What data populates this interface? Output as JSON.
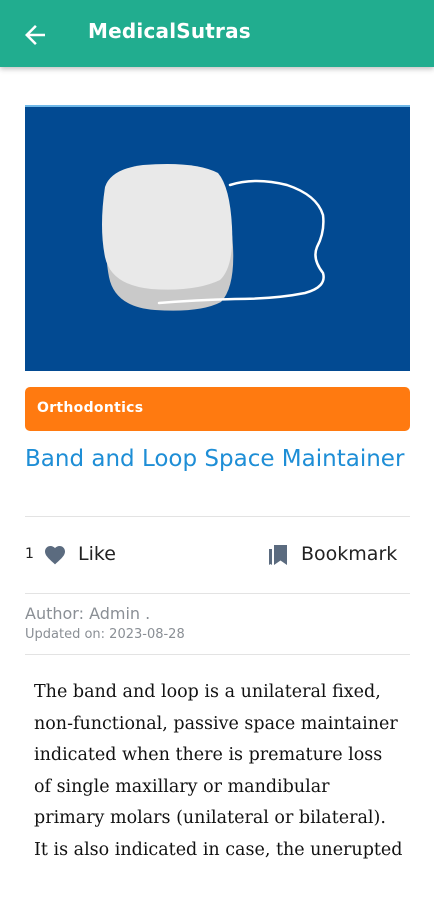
{
  "appbar": {
    "title": "MedicalSutras"
  },
  "article": {
    "category": "Orthodontics",
    "title": "Band and Loop Space Maintainer",
    "like_count": "1",
    "like_label": "Like",
    "bookmark_label": "Bookmark",
    "author": "Author: Admin .",
    "updated": "Updated on: 2023-08-28",
    "body": "The band and loop is a unilateral fixed, non-functional, passive space maintainer indicated when there is premature loss of single maxillary or mandibular primary molars (unilateral or bilateral). It is also indicated in case, the unerupted"
  },
  "colors": {
    "appbar": "#21ad8f",
    "hero_background": "#024a92",
    "category_badge": "#ff7a10",
    "title_link": "#1e8ed6"
  },
  "icons": {
    "back": "arrow-left-icon",
    "like": "heart-icon",
    "bookmark": "bookmark-icon"
  }
}
